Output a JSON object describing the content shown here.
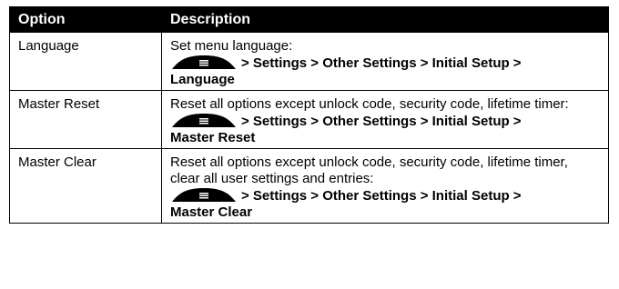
{
  "table": {
    "headers": {
      "option": "Option",
      "description": "Description"
    },
    "rows": [
      {
        "option": "Language",
        "description": "Set menu language:",
        "path_line1": "> Settings > Other Settings > Initial Setup >",
        "path_line2": "Language"
      },
      {
        "option": "Master Reset",
        "description": "Reset all options except unlock code, security code, lifetime timer:",
        "path_line1": "> Settings > Other Settings > Initial Setup >",
        "path_line2": "Master Reset"
      },
      {
        "option": "Master Clear",
        "description": "Reset all options except unlock code, security code, lifetime timer, clear all user settings and entries:",
        "path_line1": "> Settings > Other Settings > Initial Setup >",
        "path_line2": "Master Clear"
      }
    ]
  },
  "icons": {
    "menu_key": "menu-key-icon"
  }
}
